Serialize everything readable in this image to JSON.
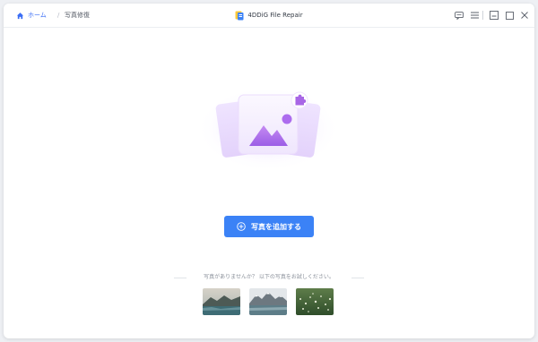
{
  "breadcrumb": {
    "home_label": "ホーム",
    "separator": "/",
    "current_label": "写真修復"
  },
  "app": {
    "title": "4DDiG File Repair"
  },
  "main": {
    "add_button_label": "写真を追加する",
    "sample_hint": "写真がありませんか？ 以下の写真をお試しください。",
    "sample_photos": [
      {
        "name": "mountain-lake"
      },
      {
        "name": "snowy-peaks"
      },
      {
        "name": "grass-field"
      }
    ]
  },
  "colors": {
    "accent": "#3b82f6",
    "link": "#3b6ef5",
    "hero_purple": "#a866e6"
  },
  "icons": [
    "home-icon",
    "app-logo-icon",
    "feedback-icon",
    "menu-icon",
    "minimize-icon",
    "maximize-icon",
    "close-icon",
    "image-icon",
    "puzzle-icon",
    "add-circle-icon"
  ]
}
